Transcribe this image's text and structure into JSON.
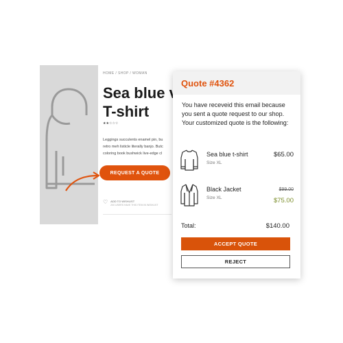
{
  "product": {
    "breadcrumb": "HOME / SHOP / WOMAN",
    "title_line1": "Sea blue v",
    "title_line2": "T-shirt",
    "rating_stars": "★★☆☆☆",
    "rating_value": 2,
    "description_lines": [
      "Leggings succulents enamel pin, bu",
      "retro meh listicle literally banjo. Butc",
      "coloring book bushwick live-edge cl"
    ],
    "request_button": "REQUEST A QUOTE",
    "wishlist_label": "ADD TO WISHLIST",
    "wishlist_sub": "200 USERS HAVE THIS ITEM IN WISHLIST"
  },
  "quote": {
    "title": "Quote #4362",
    "message": "You have receveid this email because you sent a quote request to our shop. Your customized quote is the following:",
    "items": [
      {
        "icon": "tshirt-icon",
        "name": "Sea blue t-shirt",
        "size": "Size XL",
        "price": "$65.00"
      },
      {
        "icon": "jacket-icon",
        "name": "Black Jacket",
        "size": "Size XL",
        "old_price": "$99.00",
        "price": "$75.00"
      }
    ],
    "total_label": "Total:",
    "total_value": "$140.00",
    "accept_button": "ACCEPT QUOTE",
    "reject_button": "REJECT"
  },
  "colors": {
    "accent": "#e0530d",
    "discount": "#7b8d2a"
  }
}
